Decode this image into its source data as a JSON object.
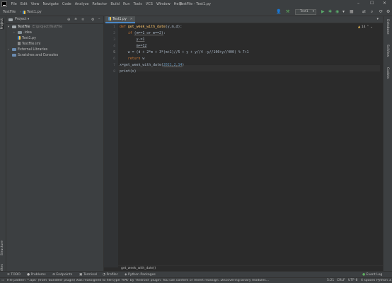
{
  "titlebar": {
    "menu": [
      "File",
      "Edit",
      "View",
      "Navigate",
      "Code",
      "Analyze",
      "Refactor",
      "Build",
      "Run",
      "Tools",
      "VCS",
      "Window",
      "Help"
    ],
    "window_title": "TestFile - Test1.py",
    "minimize": "–",
    "maximize": "☐",
    "close": "✕"
  },
  "navbar": {
    "project": "TestFile",
    "file": "Test1.py",
    "run_config": "Test1"
  },
  "project_panel": {
    "title": "Project",
    "tree": [
      {
        "label": "TestFile",
        "path": "E:\\project\\TestFile",
        "kind": "project-folder"
      },
      {
        "label": ".idea",
        "kind": "folder"
      },
      {
        "label": "Test1.py",
        "kind": "py"
      },
      {
        "label": "TestFile.iml",
        "kind": "iml"
      },
      {
        "label": "External Libraries",
        "kind": "lib"
      },
      {
        "label": "Scratches and Consoles",
        "kind": "scratch"
      }
    ]
  },
  "left_strip": {
    "project_tab": "Project",
    "structure_tab": "Structure",
    "favorites_tab": "Favorites"
  },
  "editor": {
    "tab": "Test1.py",
    "inspection_count": "14",
    "line_numbers": [
      "1",
      "2",
      "3",
      "4",
      "5",
      "6",
      "7",
      "8"
    ],
    "breadcrumb": "get_week_with_date()"
  },
  "right_strip": {
    "tabs": [
      "Database",
      "SciView",
      "Codota"
    ]
  },
  "bottom_tabs": [
    "TODO",
    "Problems",
    "Endpoints",
    "Terminal",
    "Profiler",
    "Python Packages"
  ],
  "event_log": "Event Log",
  "status": {
    "message": "File pattern '*.apk' (from 'bundled' plugin) was reassigned to file type 'APK' by 'Android' plugin: You can confirm or revert reassign.   Discovering binary modules...",
    "position": "5:21",
    "line_sep": "CRLF",
    "encoding": "UTF-8",
    "indent": "4 spaces",
    "interpreter": "Python 3.9"
  },
  "colors": {
    "accent": "#4a88c7",
    "keyword": "#cc7832",
    "function": "#ffc66d",
    "number": "#6897bb"
  }
}
